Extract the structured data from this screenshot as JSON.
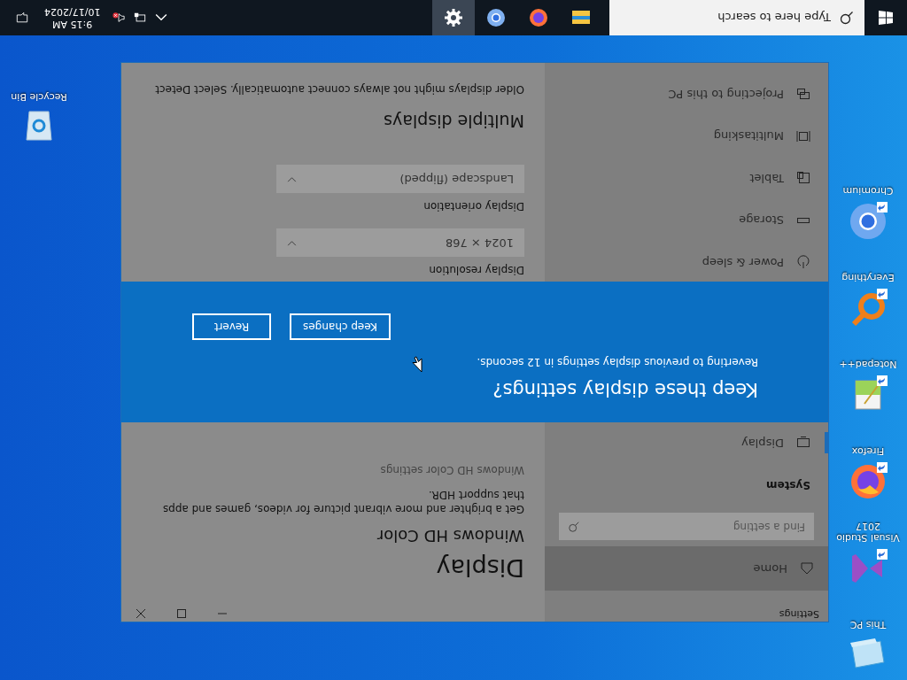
{
  "desktop_icons": [
    {
      "label": "This PC",
      "kind": "pc",
      "shortcut": false
    },
    {
      "label": "Visual Studio 2017",
      "kind": "visualstudio",
      "shortcut": true
    },
    {
      "label": "Firefox",
      "kind": "firefox",
      "shortcut": true
    },
    {
      "label": "Notepad++",
      "kind": "notepad",
      "shortcut": true
    },
    {
      "label": "Everything",
      "kind": "everything",
      "shortcut": true
    },
    {
      "label": "Chromium",
      "kind": "chromium",
      "shortcut": true
    }
  ],
  "recycle_bin": {
    "label": "Recycle Bin"
  },
  "settings_window": {
    "title": "Settings",
    "sidebar": {
      "home": {
        "label": "Home",
        "hovered": true
      },
      "search": {
        "placeholder": "Find a setting"
      },
      "section": "System",
      "items_above": [
        {
          "label": "Display",
          "kind": "display",
          "selected": true
        }
      ],
      "items_below": [
        {
          "label": "Power & sleep",
          "kind": "power",
          "selected": false
        },
        {
          "label": "Storage",
          "kind": "storage",
          "selected": false
        },
        {
          "label": "Tablet",
          "kind": "tablet",
          "selected": false
        },
        {
          "label": "Multitasking",
          "kind": "multitasking",
          "selected": false
        },
        {
          "label": "Projecting to this PC",
          "kind": "projecting",
          "selected": false
        }
      ]
    },
    "content": {
      "heading": "Display",
      "hd_color": {
        "title": "Windows HD Color",
        "description": "Get a brighter and more vibrant picture for videos, games and apps that support HDR.",
        "link": "Windows HD Color settings"
      },
      "resolution": {
        "label": "Display resolution",
        "value": "1024 × 768"
      },
      "orientation": {
        "label": "Display orientation",
        "value": "Landscape (flipped)"
      },
      "multiple": {
        "title": "Multiple displays",
        "text": "Older displays might not always connect automatically. Select Detect"
      }
    },
    "dialog": {
      "title": "Keep these display settings?",
      "message": "Reverting to previous display settings in 12 seconds.",
      "buttons": [
        "Keep changes",
        "Revert"
      ]
    }
  },
  "taskbar": {
    "search": {
      "placeholder": "Type here to search"
    },
    "apps": [
      {
        "kind": "explorer",
        "selected": false
      },
      {
        "kind": "firefox",
        "selected": false
      },
      {
        "kind": "chromium",
        "selected": false
      },
      {
        "kind": "settings",
        "selected": true
      }
    ],
    "tray": {
      "volume_muted": true,
      "time": "9:15 AM",
      "date": "10/17/2024"
    }
  }
}
